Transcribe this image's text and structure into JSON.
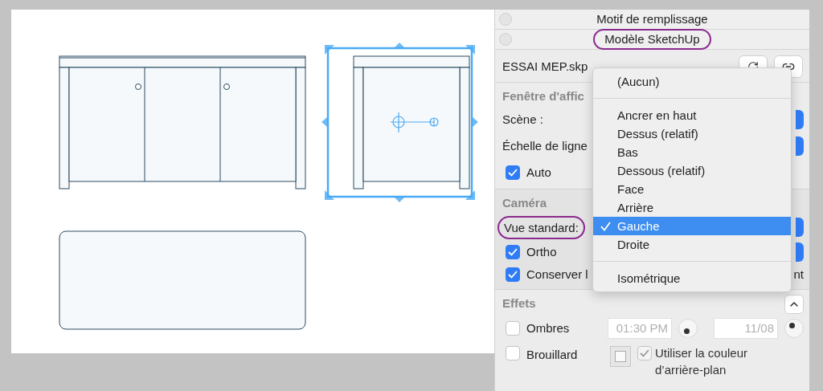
{
  "panel": {
    "sections": [
      {
        "title": "Motif de remplissage",
        "highlighted": false
      },
      {
        "title": "Modèle SketchUp",
        "highlighted": true
      }
    ],
    "model": {
      "file": "ESSAI MEP.skp"
    },
    "viewport": {
      "title": "Fenêtre d'affic",
      "scene_label": "Scène :",
      "line_scale_label": "Échelle de ligne",
      "auto": {
        "label": "Auto",
        "checked": true
      }
    },
    "camera": {
      "title": "Caméra",
      "standard_view_label": "Vue standard:",
      "highlighted": true,
      "ortho": {
        "label": "Ortho",
        "checked": true
      },
      "keep": {
        "label": "Conserver l",
        "checked": true
      },
      "keep_tail": "nt"
    },
    "effects": {
      "title": "Effets",
      "expanded": true,
      "shadows": {
        "label": "Ombres",
        "checked": false,
        "time": "01:30 PM",
        "date": "11/08"
      },
      "fog": {
        "label": "Brouillard",
        "checked": false,
        "use_background": {
          "label": "Utiliser la couleur d’arrière-plan",
          "checked": true,
          "disabled": true
        }
      }
    },
    "menu": {
      "items": [
        {
          "kind": "item",
          "label": "(Aucun)",
          "selected": false
        },
        {
          "kind": "separator"
        },
        {
          "kind": "item",
          "label": "Ancrer en haut",
          "selected": false
        },
        {
          "kind": "item",
          "label": "Dessus (relatif)",
          "selected": false
        },
        {
          "kind": "item",
          "label": "Bas",
          "selected": false
        },
        {
          "kind": "item",
          "label": "Dessous (relatif)",
          "selected": false
        },
        {
          "kind": "item",
          "label": "Face",
          "selected": false
        },
        {
          "kind": "item",
          "label": "Arrière",
          "selected": false
        },
        {
          "kind": "item",
          "label": "Gauche",
          "selected": true
        },
        {
          "kind": "item",
          "label": "Droite",
          "selected": false
        },
        {
          "kind": "separator"
        },
        {
          "kind": "item",
          "label": "Isométrique",
          "selected": false
        }
      ]
    }
  }
}
